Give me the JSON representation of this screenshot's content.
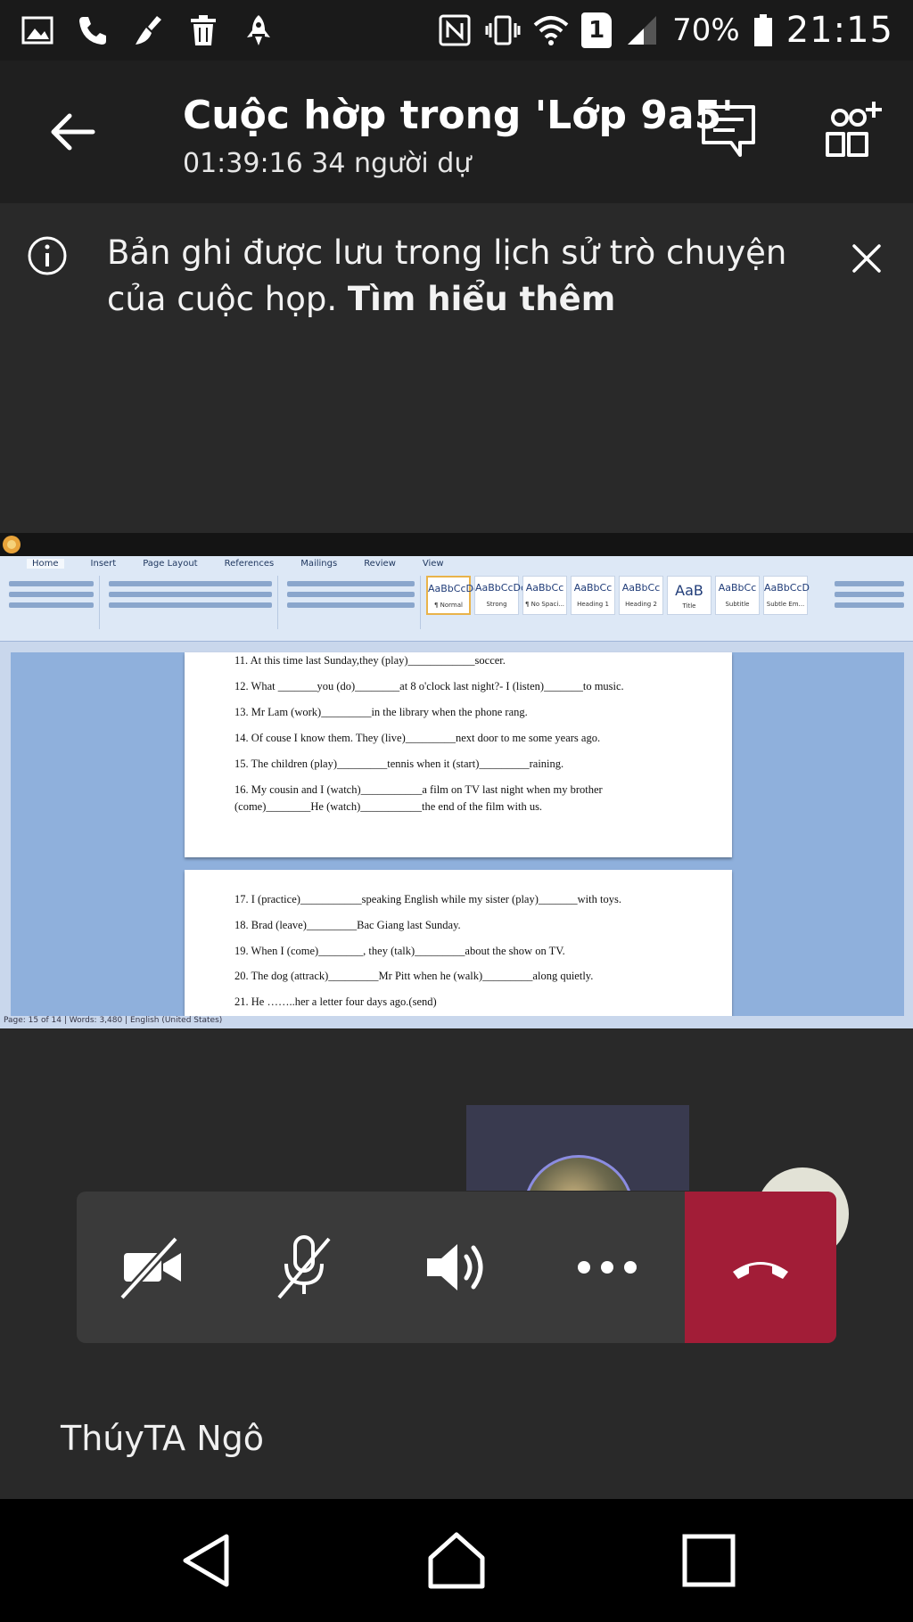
{
  "status_bar": {
    "icons": [
      "gallery-icon",
      "phone-icon",
      "broom-icon",
      "trash-icon",
      "rocket-icon",
      "nfc-icon",
      "vibrate-icon",
      "wifi-icon",
      "sim-1-icon",
      "signal-icon",
      "battery-icon"
    ],
    "sim_label": "1",
    "battery": "70%",
    "time": "21:15"
  },
  "header": {
    "title": "Cuộc hờp trong 'Lớp 9a5'",
    "subtitle": "01:39:16 34 người dự"
  },
  "notice": {
    "text": "Bản ghi được lưu trong lịch sử trò chuyện của cuộc họp.",
    "link": "Tìm hiểu thêm"
  },
  "shared_screen": {
    "ribbon_tabs": [
      "Home",
      "Insert",
      "Page Layout",
      "References",
      "Mailings",
      "Review",
      "View"
    ],
    "styles": [
      {
        "sample": "AaBbCcDc",
        "name": "¶ Normal"
      },
      {
        "sample": "AaBbCcDc",
        "name": "Strong"
      },
      {
        "sample": "AaBbCc",
        "name": "¶ No Spaci..."
      },
      {
        "sample": "AaBbCc",
        "name": "Heading 1"
      },
      {
        "sample": "AaBbCc",
        "name": "Heading 2"
      },
      {
        "sample": "AaB",
        "name": "Title"
      },
      {
        "sample": "AaBbCc",
        "name": "Subtitle"
      },
      {
        "sample": "AaBbCcD",
        "name": "Subtle Em..."
      }
    ],
    "page1_lines": [
      "11. At this time last Sunday,they (play)____________soccer.",
      "12. What _______you (do)________at 8 o'clock last night?- I (listen)_______to music.",
      "13. Mr Lam (work)_________in the library when the phone rang.",
      "14. Of couse I know them. They (live)_________next door to me some years ago.",
      "15. The children (play)_________tennis when it (start)_________raining.",
      "16. My cousin and I (watch)___________a film on TV last night when my brother",
      "(come)________He (watch)___________the end of the film with us."
    ],
    "page2_lines": [
      "17. I (practice)___________speaking English while my sister (play)_______with toys.",
      "18. Brad (leave)_________Bac Giang last Sunday.",
      "19. When I (come)________, they (talk)_________about the show on TV.",
      "20. The dog (attrack)_________Mr Pitt when he (walk)_________along quietly.",
      "21. He ……..her a letter four days ago.(send)"
    ],
    "status_text": "Page: 15 of 14 | Words: 3,480 | English (United States)"
  },
  "controls": {
    "camera": "camera-off-icon",
    "mic": "mic-off-icon",
    "speaker": "speaker-icon",
    "more": "more-icon",
    "hangup": "hang-up-icon",
    "hangup_color": "#a21d37"
  },
  "participant": {
    "name": "ThúyTA Ngô"
  }
}
